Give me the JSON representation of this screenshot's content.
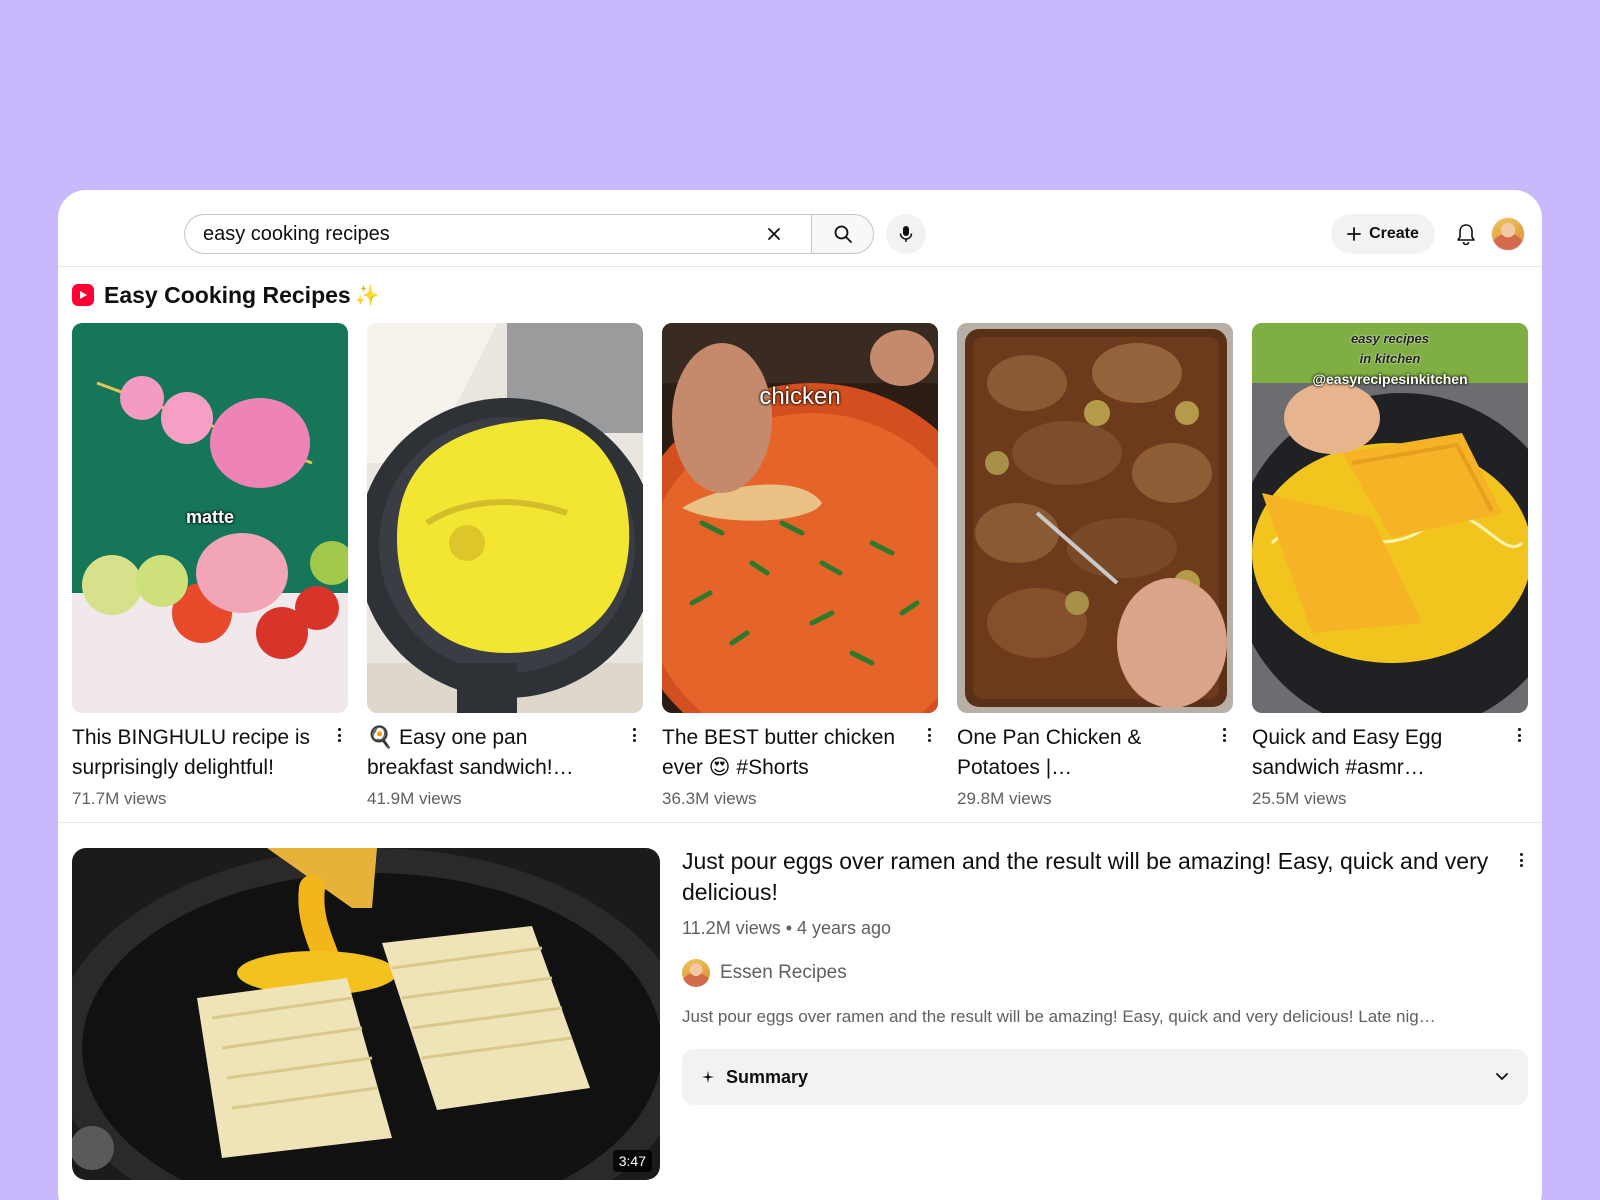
{
  "search": {
    "value": "easy cooking recipes",
    "placeholder": "Search"
  },
  "header": {
    "create_label": "Create"
  },
  "icons": {
    "clear": "close-icon",
    "search": "search-icon",
    "mic": "mic-icon",
    "create": "plus-icon",
    "bell": "bell-icon",
    "shorts": "shorts-logo-icon",
    "more": "more-vert-icon",
    "summary": "sparkle-icon",
    "expand": "chevron-down-icon"
  },
  "colors": {
    "shorts_red": "#ff0033",
    "page_bg": "#c9b8fb",
    "meta_gray": "#606060"
  },
  "shelf": {
    "title": "Easy Cooking Recipes",
    "title_emoji": "✨",
    "shorts": [
      {
        "title": "This BINGHULU recipe is surprisingly delightful!",
        "views": "71.7M views",
        "caption": "matte"
      },
      {
        "title": "🍳 Easy one pan breakfast sandwich!…",
        "views": "41.9M views",
        "caption": ""
      },
      {
        "title": "The BEST butter chicken ever 😍  #Shorts",
        "views": "36.3M views",
        "caption": "chicken"
      },
      {
        "title": "One Pan Chicken & Potatoes |…",
        "views": "29.8M views",
        "caption": ""
      },
      {
        "title": "Quick and Easy Egg sandwich #asmr…",
        "views": "25.5M views",
        "caption": "@easyrecipesinkitchen",
        "watermark_line1": "easy recipes",
        "watermark_line2": "in kitchen"
      }
    ]
  },
  "video": {
    "title": "Just pour eggs over ramen and the result will be amazing! Easy, quick and very delicious!",
    "meta": "11.2M views • 4 years ago",
    "channel": "Essen Recipes",
    "description": "Just pour eggs over ramen and the result will be amazing! Easy, quick and very delicious! Late nig…",
    "duration": "3:47",
    "summary_label": "Summary"
  }
}
